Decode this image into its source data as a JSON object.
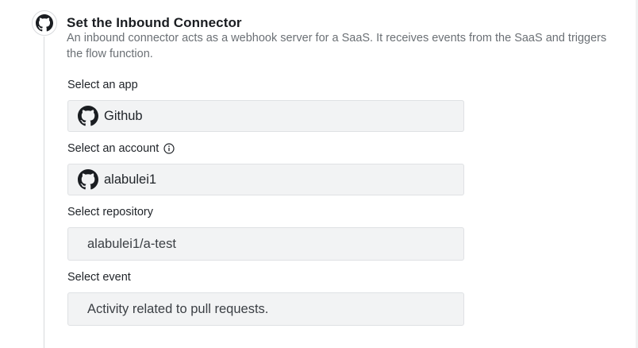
{
  "step": {
    "icon": "github-icon",
    "title": "Set the Inbound Connector",
    "description": "An inbound connector acts as a webhook server for a SaaS. It receives events from the SaaS and triggers the flow function."
  },
  "fields": {
    "app": {
      "label": "Select an app",
      "value": "Github",
      "icon": "github-icon"
    },
    "account": {
      "label": "Select an account",
      "info_icon": "info-icon",
      "value": "alabulei1",
      "icon": "github-icon"
    },
    "repository": {
      "label": "Select repository",
      "value": "alabulei1/a-test"
    },
    "event": {
      "label": "Select event",
      "value": "Activity related to pull requests."
    }
  }
}
